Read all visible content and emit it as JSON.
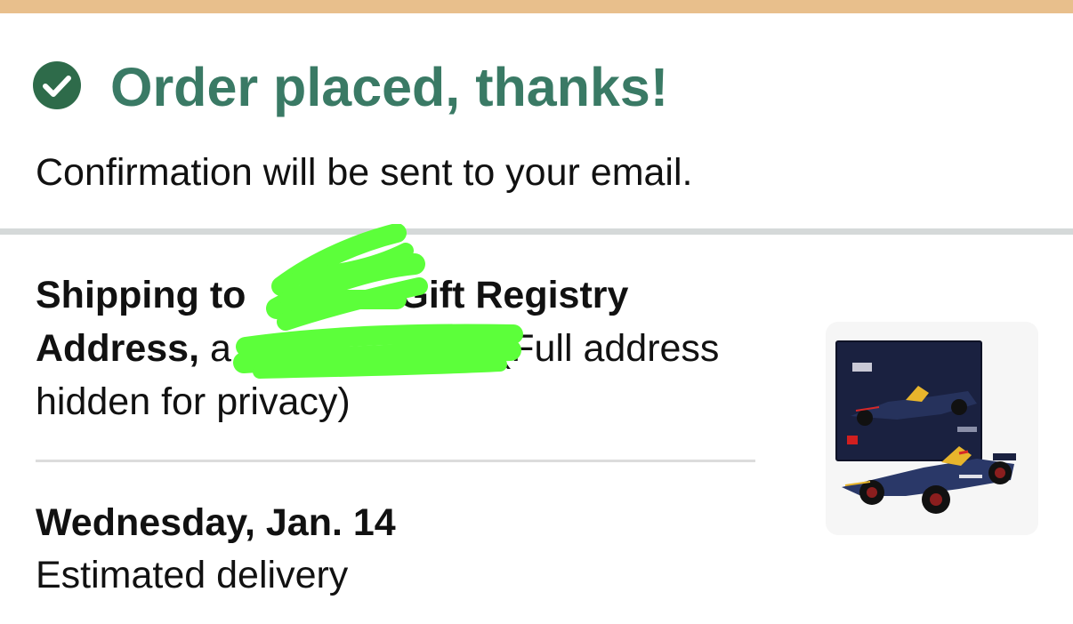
{
  "header": {
    "title": "Order placed, thanks!",
    "subtitle": "Confirmation will be sent to your email."
  },
  "shipping": {
    "bold_prefix": "Shipping to ",
    "bold_registry": "Gift Registry Address,",
    "address_start": " a",
    "note": "(Full address hidden for privacy)"
  },
  "delivery": {
    "date": "Wednesday, Jan. 14",
    "label": "Estimated delivery"
  },
  "colors": {
    "accent_bar": "#e8bf8c",
    "success_green": "#3a7a65",
    "check_circle": "#2e6b4a",
    "redaction": "#5cff3a",
    "divider": "#d5d9d9"
  },
  "icons": {
    "status": "check-circle-icon",
    "product": "lego-f1-car-box-image"
  }
}
